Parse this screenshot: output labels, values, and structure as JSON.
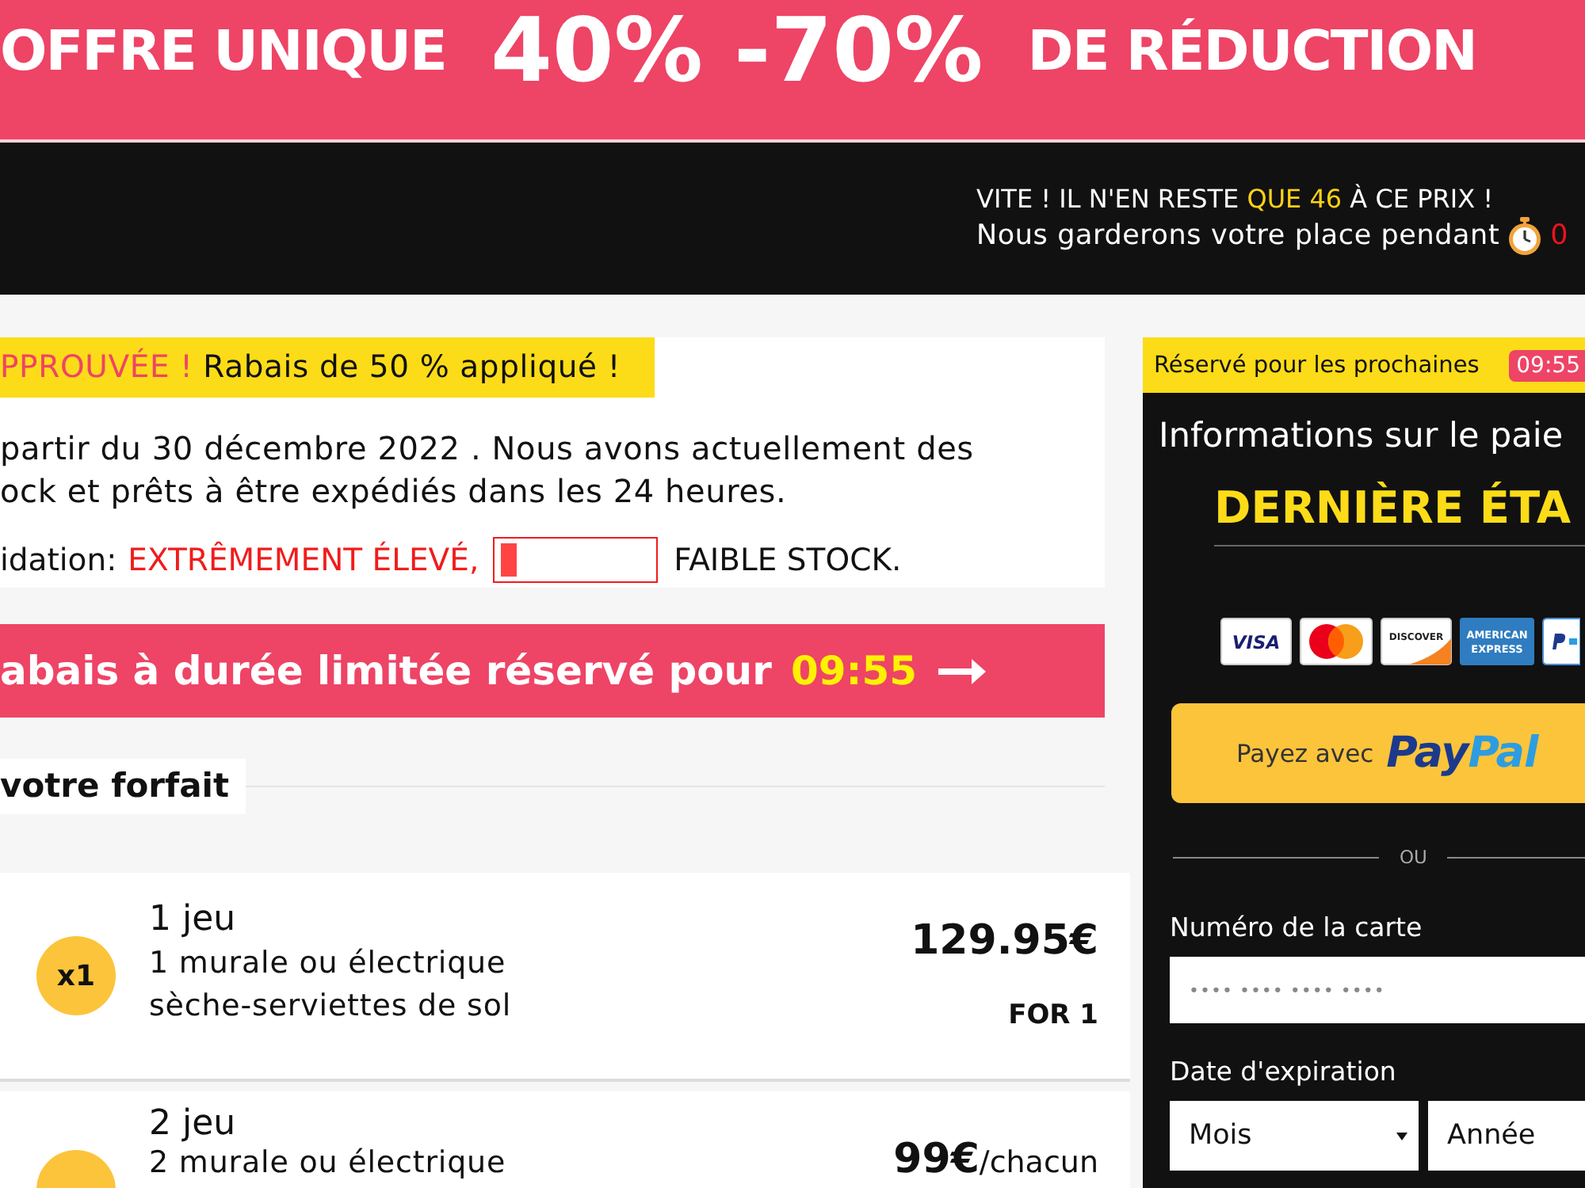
{
  "promo_banner": {
    "lead": "OFFRE UNIQUE",
    "discount": "40% -70%",
    "tail": "DE RÉDUCTION"
  },
  "urgency_bar": {
    "stock_message": [
      {
        "text": "VITE ! IL N'EN RESTE ",
        "accent": false
      },
      {
        "text": "QUE 46",
        "accent": true
      },
      {
        "text": " À CE PRIX !",
        "accent": false
      }
    ],
    "hold_message": "Nous garderons votre place pendant",
    "countdown": "0"
  },
  "approval": [
    {
      "text": "PPROUVÉE !",
      "accent": true
    },
    {
      "text": " Rabais de 50 % appliqué !",
      "accent": false
    }
  ],
  "stock_notice": [
    "partir du 30 décembre 2022 . Nous avons actuellement des",
    "ock et prêts à être expédiés dans les 24 heures."
  ],
  "liquidation": {
    "label": "idation:",
    "rate": "EXTRÊMEMENT ÉLEVÉ,",
    "level": 0.1,
    "stock": "FAIBLE STOCK."
  },
  "timer_banner": {
    "text": "abais à durée limitée réservé pour",
    "time": "09:55"
  },
  "section_heading": "votre forfait",
  "packages": [
    {
      "badge": "x1",
      "title": "1 jeu",
      "description": "1 murale ou électrique sèche-serviettes de sol",
      "price": "129.95€",
      "note": "FOR 1"
    },
    {
      "title": "2 jeu",
      "description": "2 murale ou électrique",
      "price": "99€",
      "price_suffix": "/chacun"
    }
  ],
  "checkout": {
    "reserve_label": "Réservé pour les prochaines",
    "reserve_time": "09:55",
    "title": "Informations sur le paie",
    "step": "DERNIÈRE ÉTA",
    "card_logos": [
      {
        "kind": "visa",
        "text": "VISA"
      },
      {
        "kind": "mastercard"
      },
      {
        "kind": "discover",
        "text": "DISCOVER"
      },
      {
        "kind": "amex",
        "lines": [
          "AMERICAN",
          "EXPRESS"
        ]
      },
      {
        "kind": "partial"
      }
    ],
    "paypal_button": {
      "label": "Payez avec",
      "logo_parts": [
        "Pay",
        "Pal"
      ]
    },
    "divider": "OU",
    "card_number": {
      "label": "Numéro de la carte",
      "placeholder": "•••• •••• •••• ••••"
    },
    "expiry": {
      "label": "Date d'expiration",
      "month": "Mois",
      "year": "Année"
    }
  }
}
